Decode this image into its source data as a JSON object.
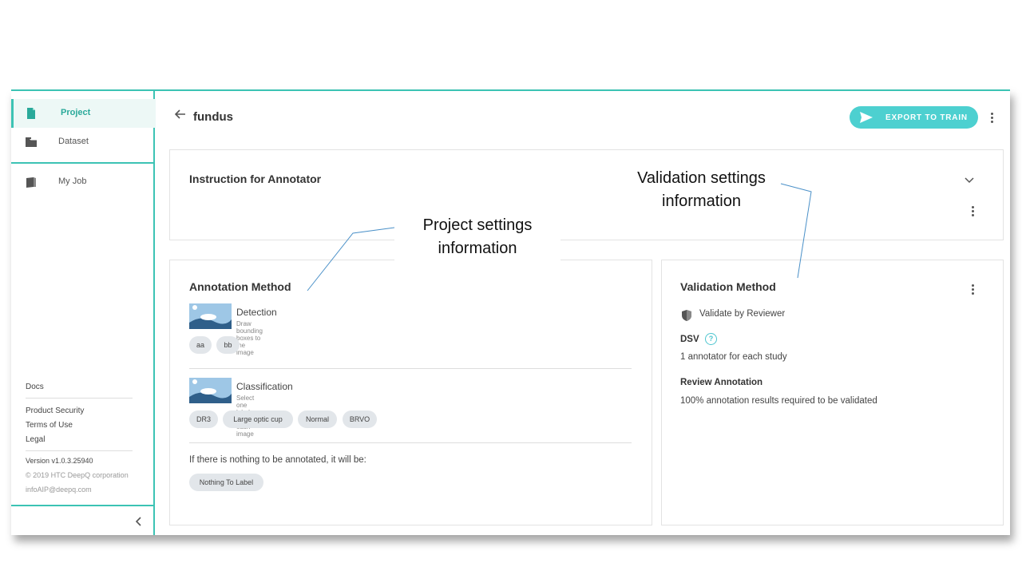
{
  "sidebar": {
    "items": [
      {
        "label": "Project",
        "icon": "file-icon"
      },
      {
        "label": "Dataset",
        "icon": "folder-icon"
      },
      {
        "label": "My Job",
        "icon": "book-icon"
      }
    ],
    "footer": {
      "docs": "Docs",
      "product_security": "Product Security",
      "terms": "Terms of Use",
      "legal": "Legal",
      "version": "Version v1.0.3.25940",
      "copyright": "© 2019 HTC DeepQ corporation",
      "email": "infoAIP@deepq.com"
    },
    "collapse_icon": "chevron-left-icon"
  },
  "header": {
    "title": "fundus",
    "export_label": "EXPORT TO TRAIN",
    "accent": "#3cc3b4",
    "button_color": "#4dd0d0"
  },
  "instruction_card": {
    "title": "Instruction for Annotator"
  },
  "annotation_card": {
    "title": "Annotation Method",
    "methods": [
      {
        "name": "Detection",
        "description": "Draw bounding boxes to the image",
        "labels": [
          "aa",
          "bb"
        ]
      },
      {
        "name": "Classification",
        "description": "Select one label for each image",
        "labels": [
          "DR3",
          "Large optic cup",
          "Normal",
          "BRVO"
        ]
      }
    ],
    "nothing_text": "If there is nothing to be annotated, it will be:",
    "nothing_label": "Nothing To Label"
  },
  "validation_card": {
    "title": "Validation Method",
    "validate_by": "Validate by Reviewer",
    "dsv_label": "DSV",
    "dsv_value": "1 annotator for each study",
    "review_label": "Review Annotation",
    "review_value": "100% annotation results required to be validated"
  },
  "annotations": {
    "project_callout": [
      "Project settings",
      "information"
    ],
    "validation_callout": [
      "Validation settings",
      "information"
    ]
  }
}
